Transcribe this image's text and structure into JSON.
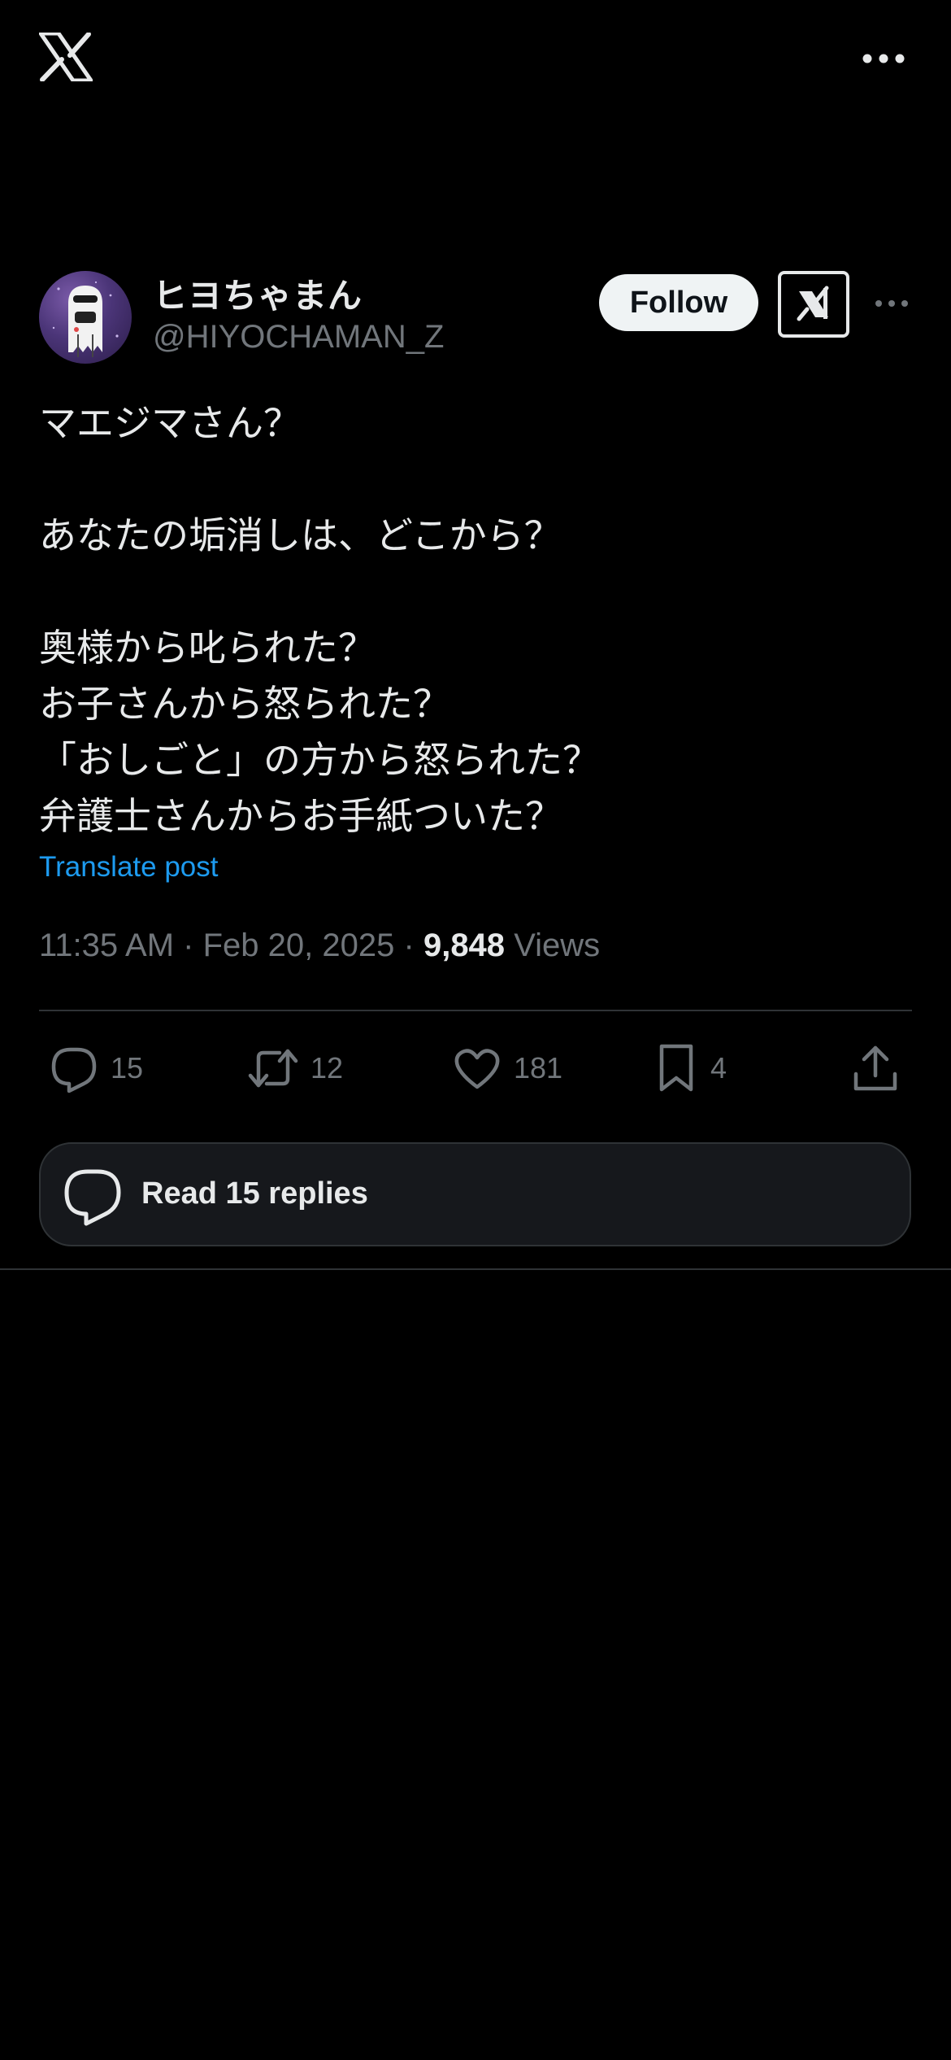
{
  "app": {
    "logo_icon": "x-logo-icon"
  },
  "post": {
    "author": {
      "display_name": "ヒヨちゃまん",
      "handle": "@HIYOCHAMAN_Z"
    },
    "follow_label": "Follow",
    "body_lines": [
      "マエジマさん？",
      "",
      "あなたの垢消しは、どこから？",
      "",
      "奥様から叱られた？",
      "お子さんから怒られた？",
      "「おしごと」の方から怒られた？",
      "弁護士さんからお手紙ついた？"
    ],
    "translate_label": "Translate post",
    "time": "11:35 AM",
    "date": "Feb 20, 2025",
    "views_count": "9,848",
    "views_label": "Views",
    "separator": "·",
    "actions": {
      "replies": "15",
      "reposts": "12",
      "likes": "181",
      "bookmarks": "4"
    },
    "read_replies_label": "Read 15 replies"
  },
  "colors": {
    "background": "#000000",
    "text": "#e7e9ea",
    "secondary": "#71767b",
    "accent": "#1d9bf0",
    "border": "#2f3336"
  }
}
